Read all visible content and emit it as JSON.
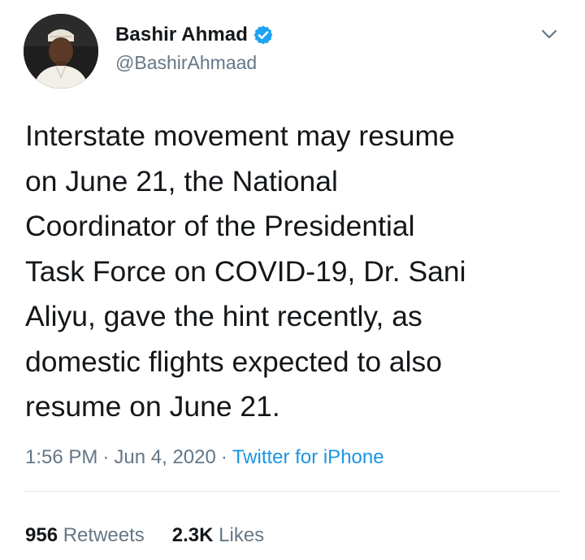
{
  "author": {
    "display_name": "Bashir Ahmad",
    "handle": "@BashirAhmaad",
    "verified_badge": "verified-check-icon",
    "avatar_icon": "profile-photo"
  },
  "menu_icon": "chevron-down-icon",
  "tweet": {
    "lines": [
      "Interstate movement may resume",
      "on June 21, the National",
      "Coordinator of the Presidential",
      "Task Force on COVID-19, Dr. Sani",
      "Aliyu, gave the hint recently, as",
      "domestic flights expected to also",
      "resume on June 21."
    ]
  },
  "meta": {
    "time": "1:56 PM",
    "separator": "·",
    "date": "Jun 4, 2020",
    "source": "Twitter for iPhone"
  },
  "stats": {
    "retweets_count": "956",
    "retweets_label": "Retweets",
    "likes_count": "2.3K",
    "likes_label": "Likes"
  },
  "colors": {
    "text_primary": "#14171a",
    "text_secondary": "#657786",
    "link_blue": "#1b95e0",
    "verified_blue": "#1da1f2",
    "divider": "#e1e8ed"
  }
}
